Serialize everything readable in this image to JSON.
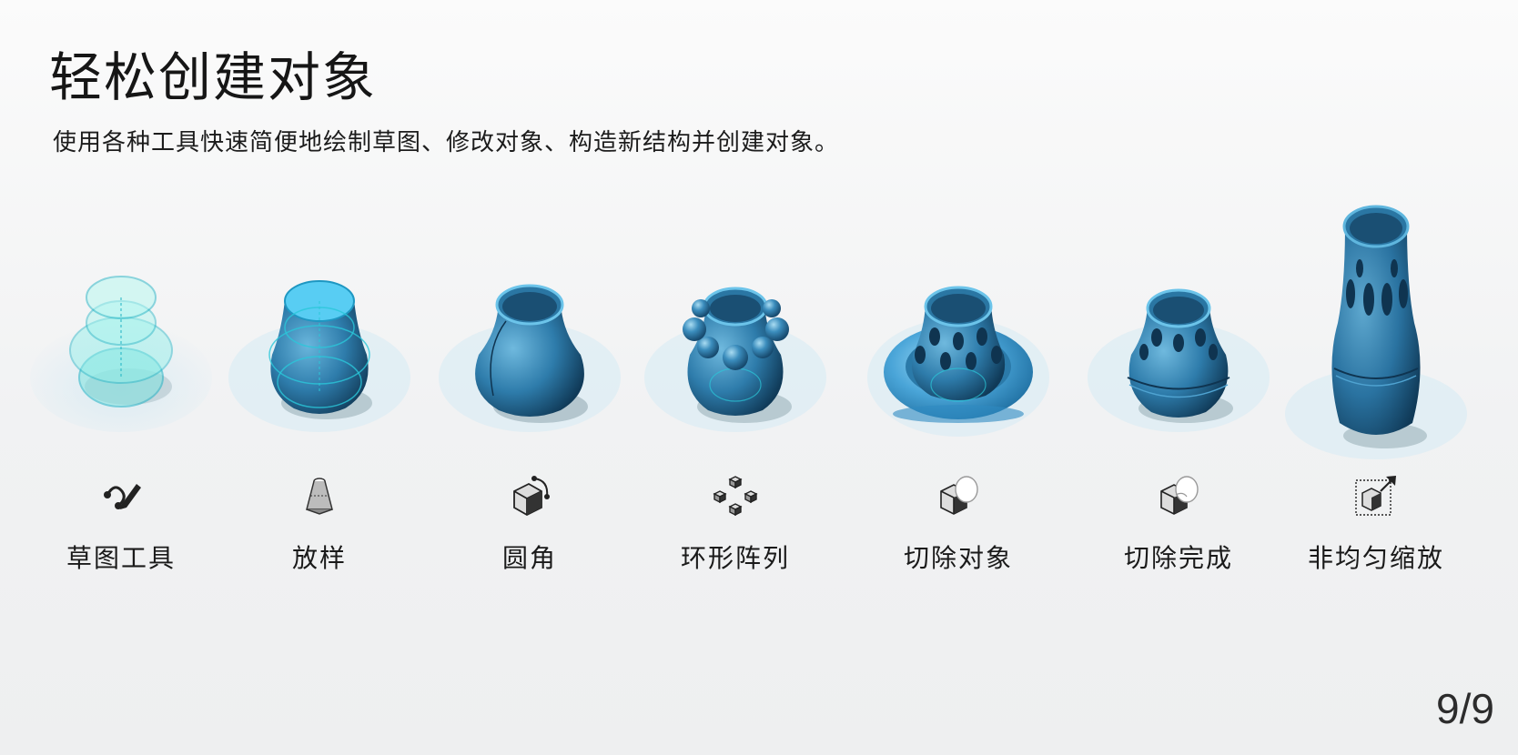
{
  "page": {
    "title": "轻松创建对象",
    "subtitle": "使用各种工具快速简便地绘制草图、修改对象、构造新结构并创建对象。",
    "pager": "9/9"
  },
  "tools": [
    {
      "label": "草图工具",
      "icon": "sketch-pen-icon"
    },
    {
      "label": "放样",
      "icon": "loft-icon"
    },
    {
      "label": "圆角",
      "icon": "fillet-icon"
    },
    {
      "label": "环形阵列",
      "icon": "circular-array-icon"
    },
    {
      "label": "切除对象",
      "icon": "cut-object-icon"
    },
    {
      "label": "切除完成",
      "icon": "cut-complete-icon"
    },
    {
      "label": "非均匀缩放",
      "icon": "non-uniform-scale-icon"
    }
  ],
  "colors": {
    "model_blue": "#2f7fae",
    "model_dark": "#1c4f72",
    "sketch_cyan": "#3cc7d6",
    "grid": "#cfe4ee"
  }
}
